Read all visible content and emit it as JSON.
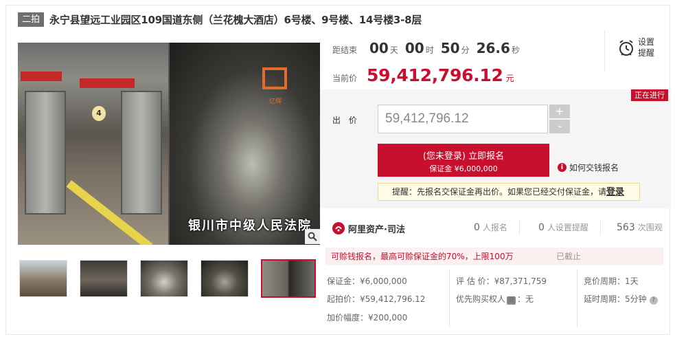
{
  "header": {
    "round_tag": "二拍",
    "title": "永宁县望远工业园区109国道东侧（兰花槐大酒店）6号楼、9号楼、14号楼3-8层"
  },
  "gallery": {
    "main_photo_logo_text": "亿辉",
    "main_photo_watermark": "银川市中级人民法院",
    "floor_sign": "4",
    "thumbnail_count": 5,
    "active_thumbnail": 5
  },
  "countdown": {
    "label": "距结束",
    "days": "00",
    "days_unit": "天",
    "hours": "00",
    "hours_unit": "时",
    "minutes": "50",
    "minutes_unit": "分",
    "seconds": "26.6",
    "seconds_unit": "秒"
  },
  "reminder": {
    "label": "设置提醒"
  },
  "current_price": {
    "label": "当前价",
    "value": "59,412,796.12",
    "unit": "元"
  },
  "bid": {
    "status": "正在进行",
    "label": "出 价",
    "input_value": "59,412,796.12",
    "plus": "+",
    "minus": "-",
    "signup_main": "(您未登录) 立即报名",
    "signup_sub": "保证金 ¥6,000,000",
    "how_to_pay": "如何交钱报名",
    "tip_text": "提醒：先报名交保证金再出价。如果您已经交付保证金，请",
    "tip_link": "登录"
  },
  "platform": {
    "name": "阿里资产·司法",
    "signups_value": "0",
    "signups_label": "人报名",
    "reminders_value": "0",
    "reminders_label": "人设置提醒",
    "views_value": "563",
    "views_label": "次围观"
  },
  "loan": {
    "text": "可赊钱报名，最高可赊保证金的70%，上限100万",
    "status": "已截止"
  },
  "info": {
    "deposit": "保证金：¥6,000,000",
    "start_price": "起拍价：¥59,412,796.12",
    "increment": "加价幅度：¥200,000",
    "valuation": "评 估 价：¥87,371,759",
    "priority_label": "优先购买权人",
    "priority_badge": "说",
    "priority_value": "：无",
    "cycle": "竞价周期：1天",
    "delay": "延时周期：5分钟",
    "delay_help": "?"
  },
  "colors": {
    "accent": "#c8102e",
    "tag_gray": "#6f6f6f"
  }
}
